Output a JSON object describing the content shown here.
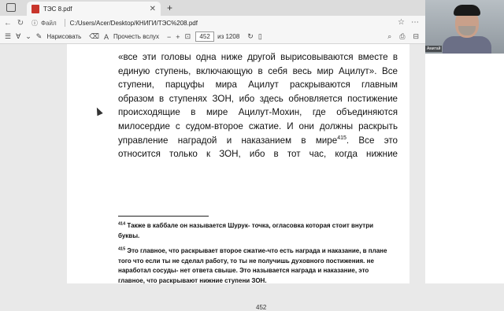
{
  "browser": {
    "tab_title": "ТЭС 8.pdf",
    "tab_close": "✕",
    "new_tab": "+",
    "file_label": "Файл",
    "path": "C:/Users/Acer/Desktop/КНИГИ/ТЭС%208.pdf"
  },
  "toolbar": {
    "draw_label": "Нарисовать",
    "read_aloud_label": "Прочесть вслух",
    "page_current": "452",
    "page_total": "из 1208"
  },
  "document": {
    "lines": [
      "«все эти головы одна ниже другой вырисовываются вместе в",
      "единую ступень, включающую в себя весь мир Ацилут». Все",
      "ступени, парцуфы мира Ацилут раскрываются главным",
      "образом в ступенях ЗОН, ибо здесь обновляется постижение",
      "происходящие в мире Ацилут-Мохин, где объединяются",
      "милосердие с судом-второе сжатие. И они должны раскрыть",
      "управление наградой и наказанием в мире",
      "относится только к ЗОН, ибо в тот час, когда нижние"
    ],
    "line7_sup": "415",
    "line7_tail": ". Все это",
    "footnote1_num": "414",
    "footnote1_text": " Также в каббале он называется Шурук- точка, огласовка которая стоит внутри буквы.",
    "footnote2_num": "415",
    "footnote2_text": " Это главное, что раскрывает второе сжатие-что есть награда и наказание, в плане того что если ты не сделал работу, то ты не получишь духовного постижения. не наработал сосуды- нет ответа свыше. Это называется награда и наказание, это главное, что раскрывают нижние ступени ЗОН.",
    "page_number": "452"
  },
  "webcam": {
    "name_label": "Амитай"
  }
}
